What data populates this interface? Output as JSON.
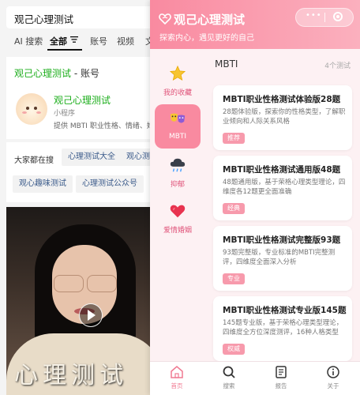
{
  "search": {
    "query": "观己心理测试",
    "tabs": [
      "AI 搜索",
      "全部",
      "账号",
      "视频",
      "文"
    ]
  },
  "account_card": {
    "section_title": "观己心理测试",
    "section_suffix": " - 账号",
    "name": "观己心理测试",
    "type": "小程序",
    "desc": "提供 MBTI 职业性格、情绪、婚"
  },
  "also_search": {
    "title": "大家都在搜",
    "chips": [
      "心理测试大全",
      "观心测",
      "观心趣味测试",
      "心理测试公众号"
    ]
  },
  "video": {
    "overlay_text": "心理测试"
  },
  "app": {
    "title": "观己心理测试",
    "subtitle": "探索内心，遇见更好的自己",
    "capsule_more": "•••",
    "accent": "#f98aa0"
  },
  "sidebar": {
    "items": [
      {
        "label": "我的收藏",
        "icon": "star-icon"
      },
      {
        "label": "MBTI",
        "icon": "mbti-masks-icon"
      },
      {
        "label": "抑郁",
        "icon": "rain-cloud-icon"
      },
      {
        "label": "爱情婚姻",
        "icon": "heart-icon"
      }
    ]
  },
  "content": {
    "section_title": "MBTI",
    "count": "4个测试",
    "tests": [
      {
        "title": "MBTI职业性格测试体验版28题",
        "desc": "28题体验版，探索你的性格类型，了解职业倾向和人际关系风格",
        "badge": "推荐"
      },
      {
        "title": "MBTI职业性格测试通用版48题",
        "desc": "48题通用版，基于荣格心理类型理论，四维度各12题更全面准确",
        "badge": "经典"
      },
      {
        "title": "MBTI职业性格测试完整版93题",
        "desc": "93题完整版，专业标准的MBTI完整测评，四维度全面深入分析",
        "badge": "专业"
      },
      {
        "title": "MBTI职业性格测试专业版145题",
        "desc": "145题专业版，基于荣格心理类型理论，四维度全方位深度测评，16种人格类型",
        "badge": "权威"
      }
    ]
  },
  "bottom_nav": {
    "items": [
      {
        "label": "首页",
        "icon": "home-icon"
      },
      {
        "label": "搜索",
        "icon": "search-icon"
      },
      {
        "label": "报告",
        "icon": "report-icon"
      },
      {
        "label": "关于",
        "icon": "info-icon"
      }
    ]
  }
}
